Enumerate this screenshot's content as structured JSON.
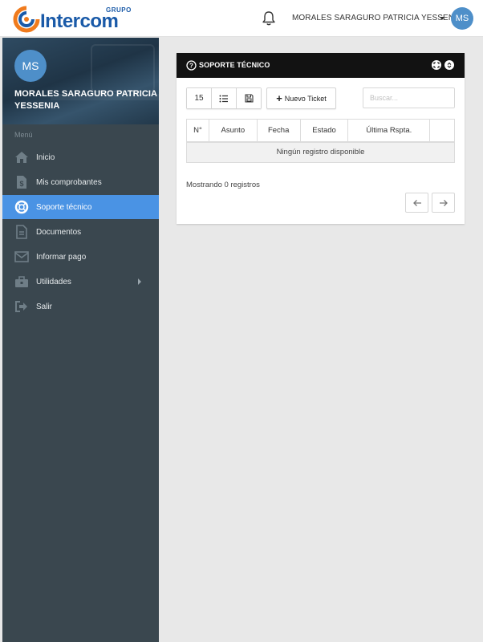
{
  "header": {
    "logo_group": "GRUPO",
    "logo_name": "Intercom",
    "user_name": "MORALES SARAGURO PATRICIA YESSENIA",
    "avatar_initials": "MS",
    "brand_color": "#1a5aa8",
    "avatar_color": "#4e8fc9"
  },
  "sidebar": {
    "avatar_initials": "MS",
    "user_name": "MORALES SARAGURO PATRICIA YESSENIA",
    "menu_label": "Menú",
    "active_color": "#4a93e4",
    "items": [
      {
        "label": "Inicio",
        "icon": "home-icon"
      },
      {
        "label": "Mis comprobantes",
        "icon": "receipt-icon"
      },
      {
        "label": "Soporte técnico",
        "icon": "life-ring-icon",
        "active": true
      },
      {
        "label": "Documentos",
        "icon": "document-icon"
      },
      {
        "label": "Informar pago",
        "icon": "envelope-icon"
      },
      {
        "label": "Utilidades",
        "icon": "toolbox-icon",
        "has_submenu": true
      },
      {
        "label": "Salir",
        "icon": "sign-out-icon"
      }
    ]
  },
  "card": {
    "title": "SOPORTE TÉCNICO",
    "page_size": "15",
    "new_ticket_label": "Nuevo Ticket",
    "search_placeholder": "Buscar...",
    "columns": [
      "N°",
      "Asunto",
      "Fecha",
      "Estado",
      "Última Rspta.",
      ""
    ],
    "empty_message": "Ningún registro disponible",
    "showing_text": "Mostrando 0 registros"
  }
}
